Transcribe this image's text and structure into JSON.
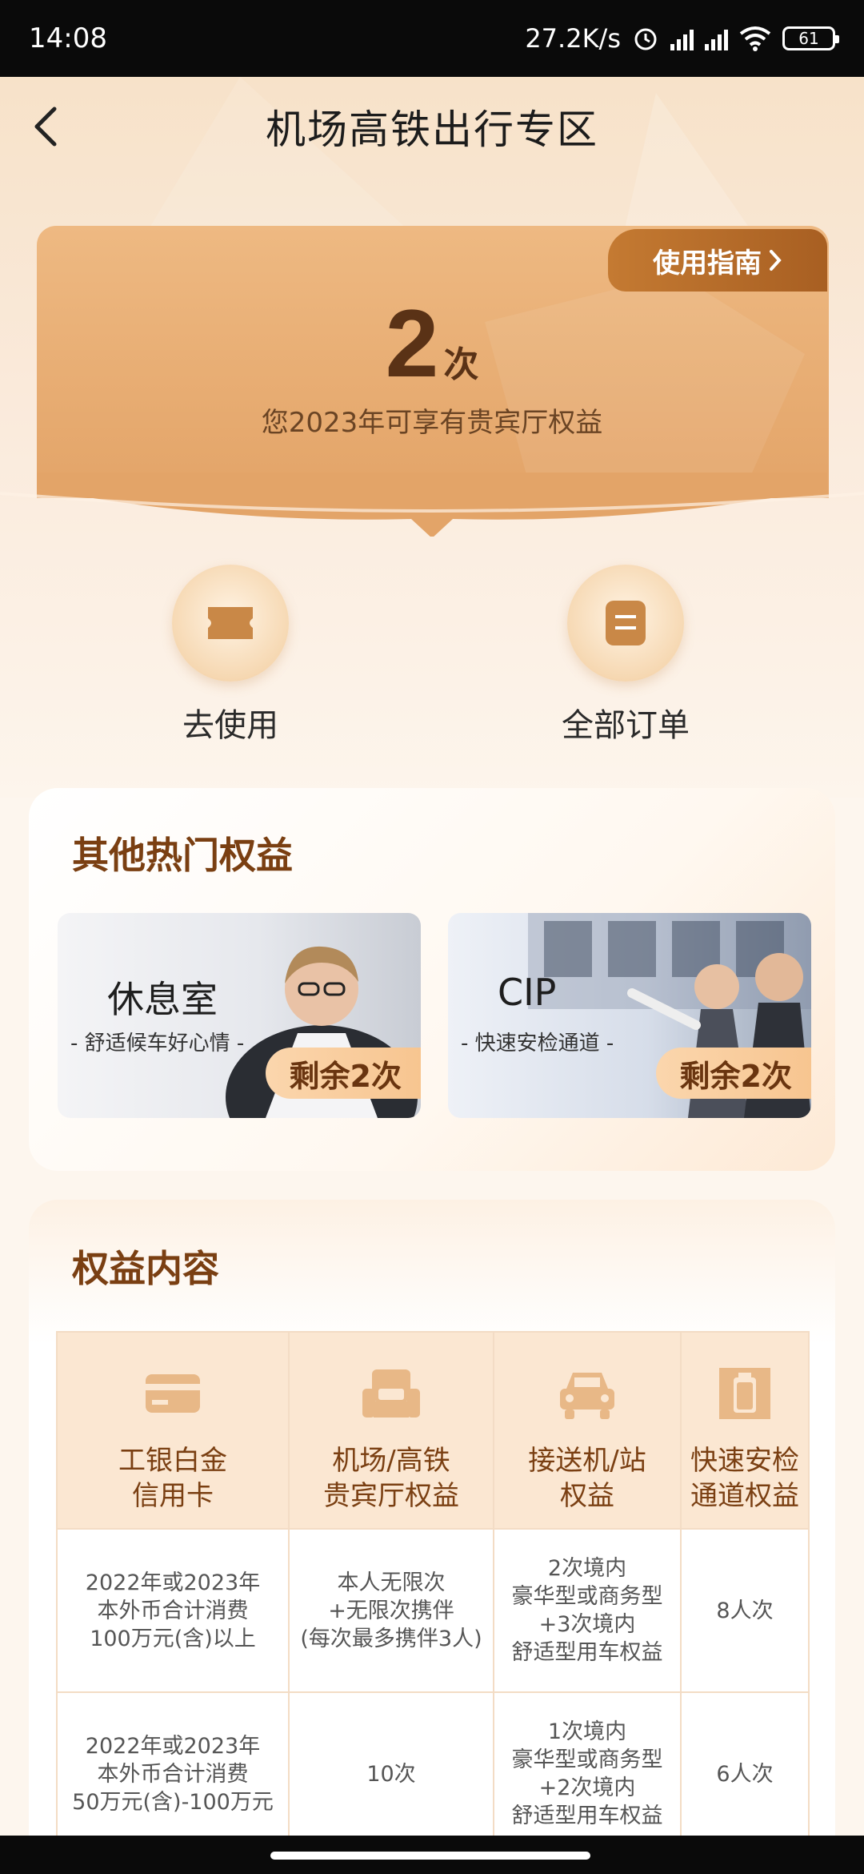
{
  "status_bar": {
    "time": "14:08",
    "net_speed": "27.2K/s",
    "battery": "61",
    "icons": [
      "alarm-icon",
      "signal-hd-icon",
      "signal-hd-icon",
      "wifi-icon",
      "battery-icon"
    ]
  },
  "nav": {
    "title": "机场高铁出行专区",
    "back_icon": "back-chevron-icon"
  },
  "quota": {
    "guide_label": "使用指南",
    "count": "2",
    "unit": "次",
    "description": "您2023年可享有贵宾厅权益"
  },
  "actions": [
    {
      "label": "去使用",
      "icon": "ticket-icon"
    },
    {
      "label": "全部订单",
      "icon": "order-icon"
    }
  ],
  "hot_benefits": {
    "title": "其他热门权益",
    "items": [
      {
        "name": "休息室",
        "subtitle": "- 舒适候车好心情 -",
        "remaining": "剩余2次"
      },
      {
        "name": "CIP",
        "subtitle": "- 快速安检通道 -",
        "remaining": "剩余2次"
      }
    ]
  },
  "rights": {
    "title": "权益内容",
    "headers": [
      {
        "line1": "工银白金",
        "line2": "信用卡",
        "icon": "card-icon"
      },
      {
        "line1": "机场/高铁",
        "line2": "贵宾厅权益",
        "icon": "sofa-icon"
      },
      {
        "line1": "接送机/站",
        "line2": "权益",
        "icon": "car-icon"
      },
      {
        "line1": "快速安检",
        "line2": "通道权益",
        "icon": "luggage-icon"
      }
    ],
    "rows": [
      {
        "c1": [
          "2022年或2023年",
          "本外币合计消费",
          "100万元(含)以上"
        ],
        "c2": [
          "本人无限次",
          "+无限次携伴",
          "(每次最多携伴3人)"
        ],
        "c3": [
          "2次境内",
          "豪华型或商务型",
          "+3次境内",
          "舒适型用车权益"
        ],
        "c4": [
          "8人次"
        ]
      },
      {
        "c1": [
          "2022年或2023年",
          "本外币合计消费",
          "50万元(含)-100万元"
        ],
        "c2": [
          "10次"
        ],
        "c3": [
          "1次境内",
          "豪华型或商务型",
          "+2次境内",
          "舒适型用车权益"
        ],
        "c4": [
          "6人次"
        ]
      }
    ]
  },
  "colors": {
    "accent_brown": "#7a3f12",
    "card_gold": "#e3a468",
    "guide_tab": "#a85f22"
  }
}
